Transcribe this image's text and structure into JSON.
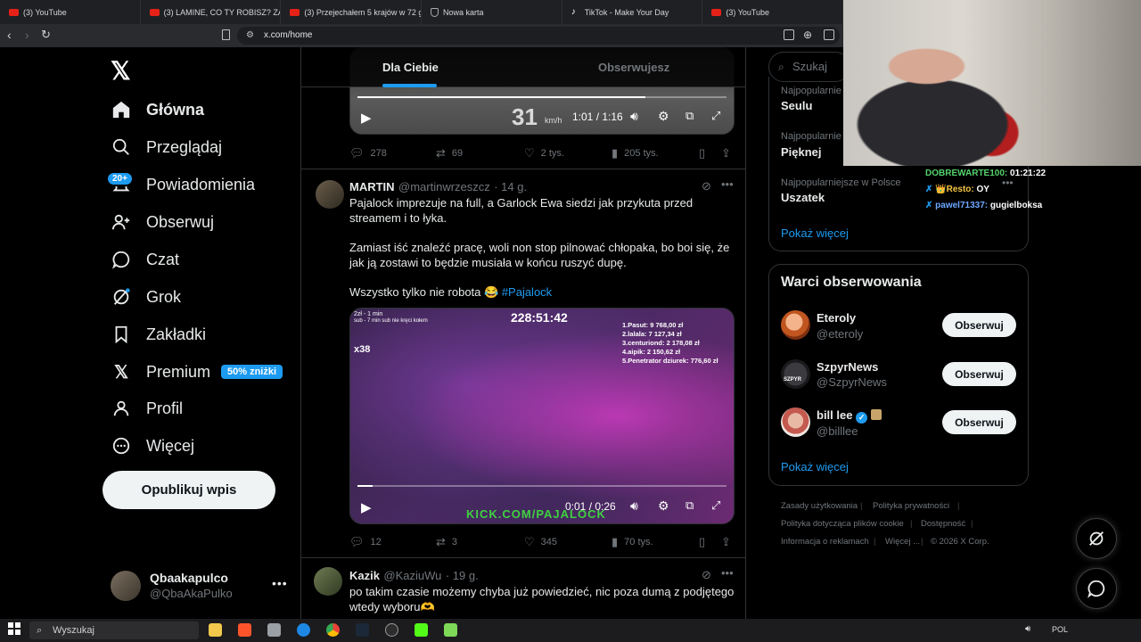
{
  "browser": {
    "tabs": [
      {
        "title": "(3) YouTube",
        "icon": "youtube-icon"
      },
      {
        "title": "(3) LAMINE, CO TY ROBISZ? ZABAW",
        "icon": "youtube-icon"
      },
      {
        "title": "(3) Przejechałem 5 krajów w 72 god",
        "icon": "youtube-icon"
      },
      {
        "title": "Nowa karta",
        "icon": "shield-icon"
      },
      {
        "title": "TikTok - Make Your Day",
        "icon": "tiktok-icon"
      },
      {
        "title": "(3) YouTube",
        "icon": "youtube-icon"
      }
    ],
    "url": "x.com/home"
  },
  "nav": {
    "items": [
      {
        "label": "Główna",
        "icon": "home-icon"
      },
      {
        "label": "Przeglądaj",
        "icon": "search-icon"
      },
      {
        "label": "Powiadomienia",
        "icon": "bell-icon"
      },
      {
        "label": "Obserwuj",
        "icon": "follow-icon"
      },
      {
        "label": "Czat",
        "icon": "chat-icon"
      },
      {
        "label": "Grok",
        "icon": "grok-icon"
      },
      {
        "label": "Zakładki",
        "icon": "bookmark-icon"
      },
      {
        "label": "Premium",
        "icon": "x-logo-icon"
      },
      {
        "label": "Profil",
        "icon": "profile-icon"
      },
      {
        "label": "Więcej",
        "icon": "more-icon"
      }
    ],
    "notif_badge": "20+",
    "premium_badge": "50% zniżki",
    "post_button": "Opublikuj wpis",
    "profile": {
      "name": "Qbaakapulco",
      "handle": "@QbaAkaPulko"
    }
  },
  "feed": {
    "tabs": [
      "Dla Ciebie",
      "Obserwujesz"
    ],
    "post0": {
      "video": {
        "speed": "31",
        "speed_unit": "km/h",
        "time": "1:01 / 1:16",
        "progress": 0.78
      },
      "stats": {
        "replies": "278",
        "reposts": "69",
        "likes": "2 tys.",
        "views": "205 tys."
      }
    },
    "post1": {
      "name": "MARTIN",
      "handle": "@martinwrzeszcz",
      "time": "· 14 g.",
      "text1": "Pajalock imprezuje na full, a Garlock Ewa siedzi jak przykuta przed streamem i to łyka.",
      "text2": "Zamiast iść znaleźć pracę, woli non stop pilnować chłopaka, bo boi się, że jak ją zostawi to będzie musiała w końcu ruszyć dupę.",
      "text3": "Wszystko tylko nie robota 😂",
      "hashtag": "#Pajalock",
      "video": {
        "timer": "228:51:42",
        "leaderboard": [
          "1.Pasut: 9 768,00 zł",
          "2.lalala: 7 127,34 zł",
          "3.centuriond: 2 178,08 zł",
          "4.aipik: 2 150,62 zł",
          "5.Penetrator dziurek: 776,60 zł"
        ],
        "overlay_top": "2zł - 1 min",
        "overlay_sub": "sub - 7 min  sub nie kręci kołem",
        "multiplier": "x38",
        "watermark": "KICK.COM/PAJALOCK",
        "time": "0:01 / 0:26",
        "progress": 0.04
      },
      "stats": {
        "replies": "12",
        "reposts": "3",
        "likes": "345",
        "views": "70 tys."
      }
    },
    "post2": {
      "name": "Kazik",
      "handle": "@KaziuWu",
      "time": "· 19 g.",
      "text": "po takim czasie możemy chyba już powiedzieć, nic poza dumą z podjętego wtedy wyboru🫶"
    }
  },
  "sidebar": {
    "search_placeholder": "Szukaj",
    "trends": [
      {
        "meta": "Najpopularnie",
        "name": "Seulu"
      },
      {
        "meta": "Najpopularnie",
        "name": "Pięknej"
      },
      {
        "meta": "Najpopularniejsze w Polsce",
        "name": "Uszatek"
      }
    ],
    "show_more": "Pokaż więcej",
    "who_to_follow_title": "Warci obserwowania",
    "who_to_follow": [
      {
        "name": "Eteroly",
        "handle": "@eteroly",
        "button": "Obserwuj"
      },
      {
        "name": "SzpyrNews",
        "handle": "@SzpyrNews",
        "button": "Obserwuj"
      },
      {
        "name": "bill lee",
        "handle": "@billlee",
        "button": "Obserwuj"
      }
    ],
    "show_more2": "Pokaż więcej",
    "footer": [
      "Zasady użytkowania",
      "Polityka prywatności",
      "Polityka dotycząca plików cookie",
      "Dostępność",
      "Informacja o reklamach",
      "Więcej ...",
      "© 2026 X Corp."
    ]
  },
  "stream_overlay": {
    "chat": [
      {
        "user": "DOBREWARTE100:",
        "msg": "01:21:22"
      },
      {
        "user": "👑Resto:",
        "msg": "OY"
      },
      {
        "user": "pawel71337:",
        "msg": "gugielboksa"
      }
    ]
  },
  "taskbar": {
    "search_placeholder": "Wyszukaj",
    "lang": "POL"
  }
}
